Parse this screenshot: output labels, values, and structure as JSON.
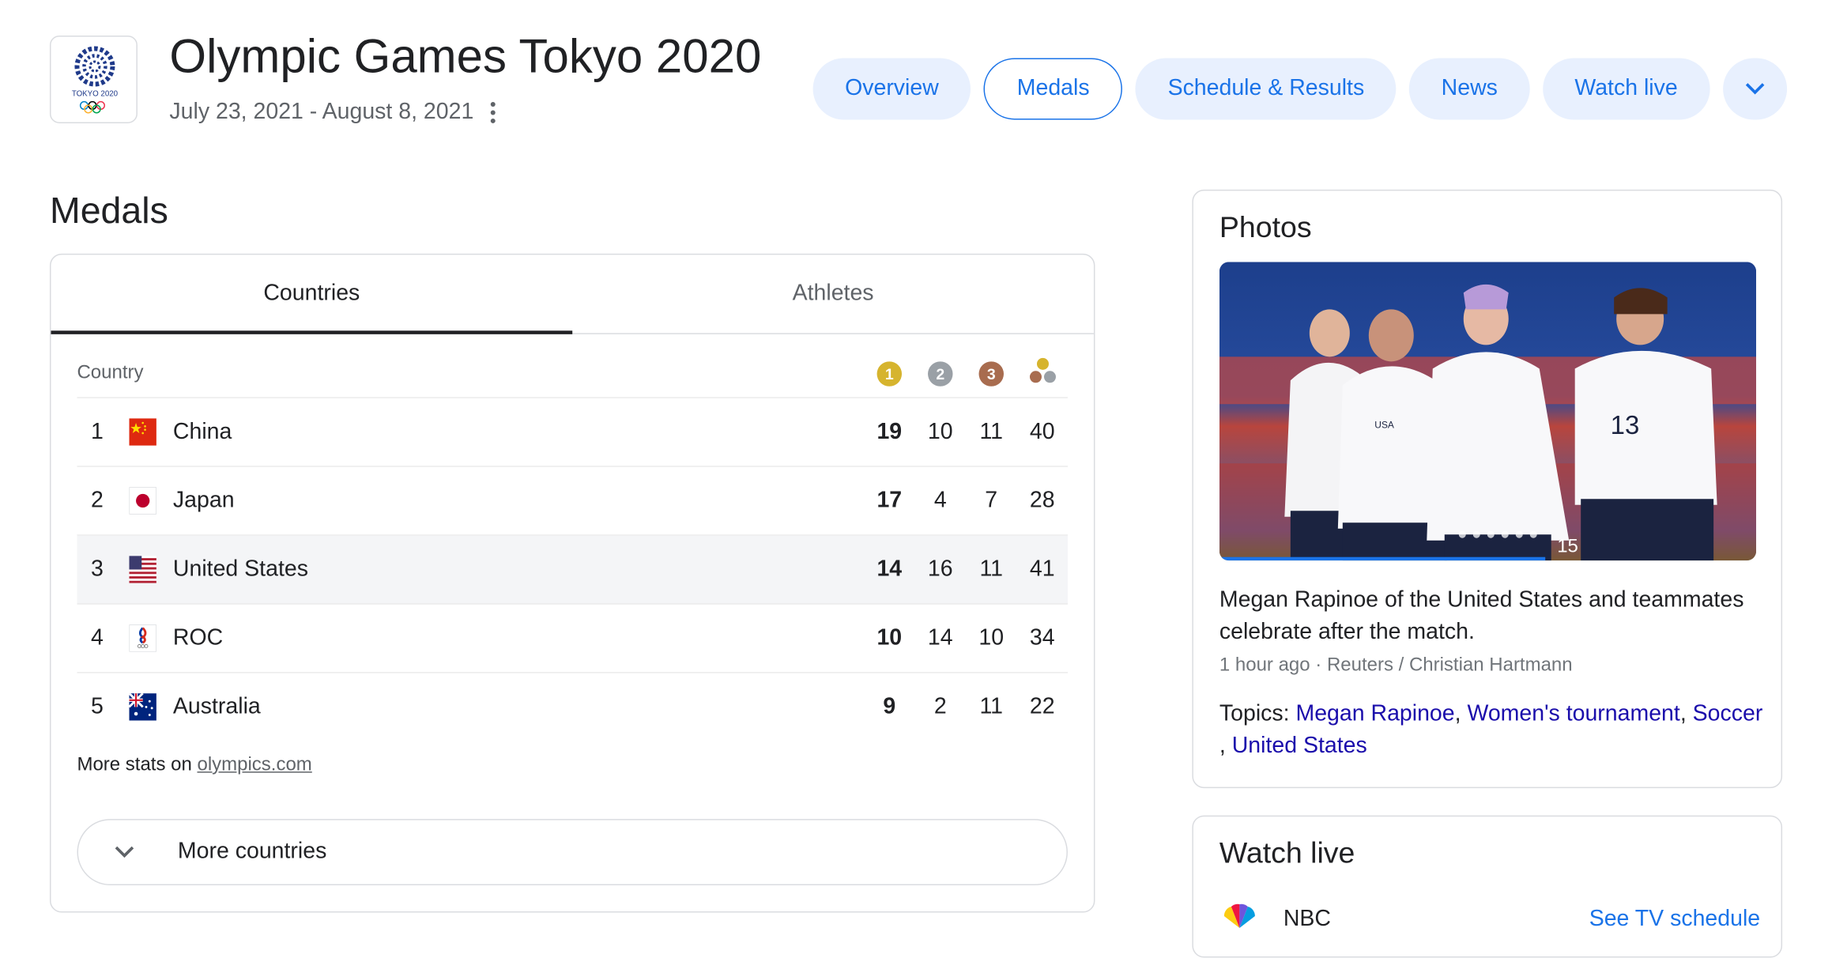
{
  "header": {
    "title": "Olympic Games Tokyo 2020",
    "dates": "July 23, 2021 - August 8, 2021",
    "logo_text": "TOKYO 2020"
  },
  "nav": {
    "tabs": [
      {
        "label": "Overview",
        "active": false
      },
      {
        "label": "Medals",
        "active": true
      },
      {
        "label": "Schedule & Results",
        "active": false
      },
      {
        "label": "News",
        "active": false
      },
      {
        "label": "Watch live",
        "active": false
      }
    ]
  },
  "medals": {
    "heading": "Medals",
    "tabs": [
      "Countries",
      "Athletes"
    ],
    "active_tab": "Countries",
    "country_header": "Country",
    "badges": [
      {
        "label": "1",
        "color": "#d6b42e"
      },
      {
        "label": "2",
        "color": "#9aa0a6"
      },
      {
        "label": "3",
        "color": "#a86c4f"
      }
    ],
    "rows": [
      {
        "rank": "1",
        "country": "China",
        "gold": "19",
        "silver": "10",
        "bronze": "11",
        "total": "40"
      },
      {
        "rank": "2",
        "country": "Japan",
        "gold": "17",
        "silver": "4",
        "bronze": "7",
        "total": "28"
      },
      {
        "rank": "3",
        "country": "United States",
        "gold": "14",
        "silver": "16",
        "bronze": "11",
        "total": "41"
      },
      {
        "rank": "4",
        "country": "ROC",
        "gold": "10",
        "silver": "14",
        "bronze": "10",
        "total": "34"
      },
      {
        "rank": "5",
        "country": "Australia",
        "gold": "9",
        "silver": "2",
        "bronze": "11",
        "total": "22"
      }
    ],
    "more_stats_prefix": "More stats on",
    "more_stats_link": "olympics.com",
    "more_countries_label": "More countries"
  },
  "photos": {
    "title": "Photos",
    "caption": "Megan Rapinoe of the United States and teammates celebrate after the match.",
    "time": "1 hour ago",
    "source": "Reuters / Christian Hartmann",
    "topics_prefix": "Topics:",
    "topics": [
      "Megan Rapinoe",
      "Women's tournament",
      "Soccer",
      "United States"
    ],
    "jersey_text": "USA",
    "numbers": [
      "13",
      "15"
    ]
  },
  "watch_live": {
    "title": "Watch live",
    "channel": "NBC",
    "schedule_link": "See TV schedule"
  },
  "colors": {
    "accent": "#1a73e8",
    "chip_bg": "#e8f0fe",
    "link": "#1a0dab"
  }
}
